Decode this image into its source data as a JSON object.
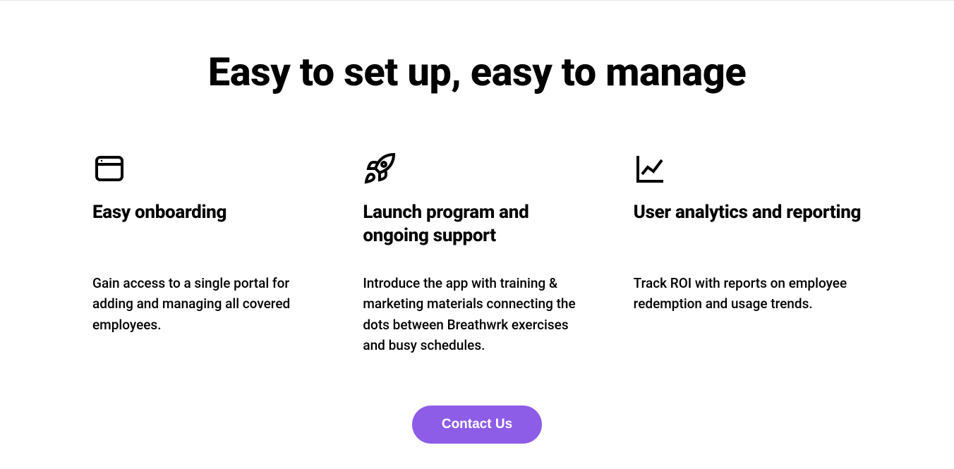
{
  "heading": "Easy to set up, easy to manage",
  "features": [
    {
      "icon": "window-icon",
      "title": "Easy onboarding",
      "desc": "Gain access to a single portal for adding and managing all covered employees."
    },
    {
      "icon": "rocket-icon",
      "title": "Launch program and ongoing support",
      "desc": "Introduce the app with training & marketing materials connecting the dots between Breathwrk exercises and busy schedules."
    },
    {
      "icon": "chart-icon",
      "title": "User analytics and reporting",
      "desc": "Track ROI with reports on employee redemption and usage trends."
    }
  ],
  "cta": {
    "label": "Contact Us"
  }
}
